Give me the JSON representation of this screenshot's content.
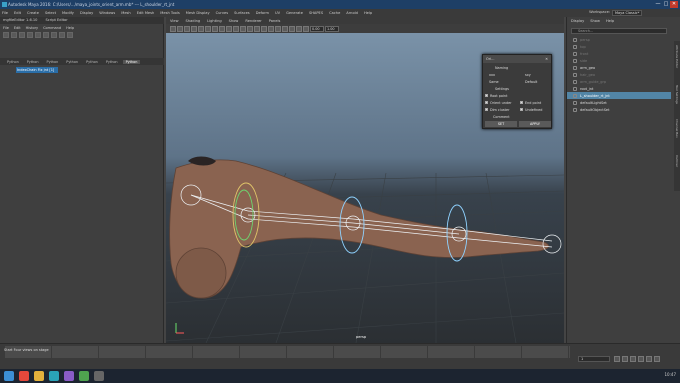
{
  "window": {
    "title": "Autodesk Maya 2016: C:/Users/.../maya_joints_orient_arm.mb*  ---  L_shoulder_rt_jnt",
    "controls": [
      "—",
      "□",
      "✕"
    ]
  },
  "menubar": {
    "items": [
      "File",
      "Edit",
      "Create",
      "Select",
      "Modify",
      "Display",
      "Windows",
      "Mesh",
      "Edit Mesh",
      "Mesh Tools",
      "Mesh Display",
      "Curves",
      "Surfaces",
      "Deform",
      "UV",
      "Generate",
      "SHAPES",
      "Cache",
      "Arnold",
      "Help"
    ],
    "workspace_label": "Workspace:",
    "workspace_value": "Maya Classic*"
  },
  "script_editor": {
    "header": [
      "mgfileEditor 1.6.10",
      "Script Editor"
    ],
    "menu": [
      "File",
      "Edit",
      "History",
      "Command",
      "Help"
    ],
    "tabs": [
      "Python",
      "Python",
      "Python",
      "Python",
      "Python",
      "Python",
      "Python"
    ],
    "active_tab_index": 6,
    "code_line": "IndexChain Fix jnt [1]"
  },
  "viewport": {
    "menu": [
      "View",
      "Shading",
      "Lighting",
      "Show",
      "Renderer",
      "Panels"
    ],
    "camera_label": "persp",
    "field_values": [
      "0.00",
      "1.00"
    ],
    "dialog": {
      "title": "Ori...",
      "rows": [
        {
          "label": "Naming"
        },
        {
          "label": "xxx",
          "right": "sxy"
        },
        {
          "label": "Same",
          "right": "Default"
        },
        {
          "label": "Settings"
        },
        {
          "label": "Root point",
          "checked": true
        },
        {
          "label": "Orient under",
          "checked": true,
          "right": "End point",
          "right_checked": true
        },
        {
          "label": "Dim cluster",
          "checked": true,
          "right": "Undefined",
          "right_checked": true
        },
        {
          "label": "Comment"
        }
      ],
      "buttons": [
        "SET",
        "APPLY"
      ]
    }
  },
  "outliner": {
    "menu": [
      "Display",
      "Show",
      "Help"
    ],
    "search_placeholder": "Search...",
    "items": [
      {
        "label": "persp",
        "state": "dim"
      },
      {
        "label": "top",
        "state": "dim"
      },
      {
        "label": "front",
        "state": "dim"
      },
      {
        "label": "side",
        "state": "dim"
      },
      {
        "label": "arm_geo",
        "state": "on"
      },
      {
        "label": "hair_geo",
        "state": "dim"
      },
      {
        "label": "arm_guide_grp",
        "state": "dim"
      },
      {
        "label": "root_jnt",
        "state": "on"
      },
      {
        "label": "L_shoulder_rt_jnt",
        "state": "sel"
      },
      {
        "label": "defaultLightSet",
        "state": "on"
      },
      {
        "label": "defaultObjectSet",
        "state": "on"
      }
    ],
    "side_tabs": [
      "Attribute Editor",
      "Tool Settings",
      "Channel Box",
      "Outliner"
    ]
  },
  "timeline": {
    "ticks": [
      0,
      10,
      20,
      30,
      40,
      50,
      60,
      70,
      80,
      90,
      100,
      110,
      120
    ],
    "command_line": "Start Four views on stage",
    "current_frame": "1"
  },
  "taskbar": {
    "time": "10:47",
    "apps": [
      "windows",
      "chrome",
      "explorer",
      "maya",
      "app4",
      "app5",
      "app6"
    ]
  },
  "colors": {
    "accent": "#5285a6",
    "title_bar": "#1e3f66",
    "selection": "#2a6ea8",
    "joint": "#e9eef2"
  }
}
